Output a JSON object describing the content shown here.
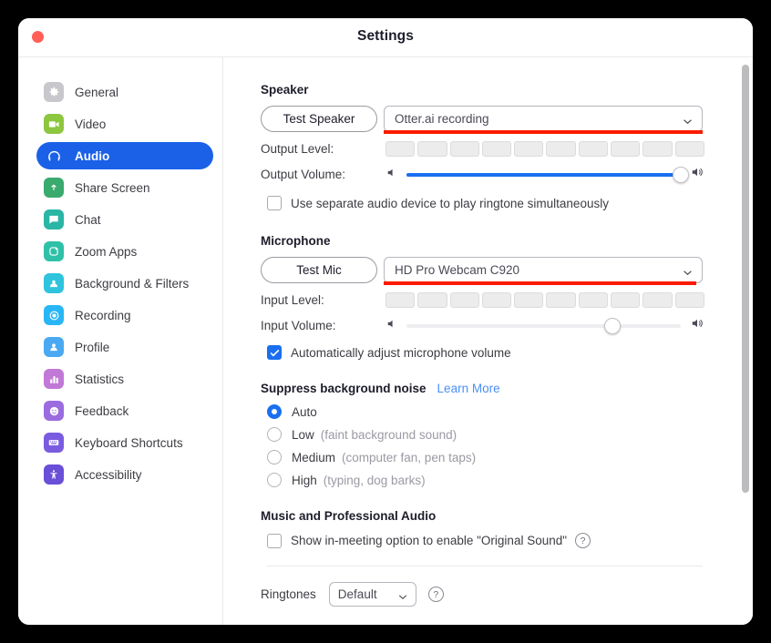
{
  "window": {
    "title": "Settings",
    "close_button": "close"
  },
  "sidebar": {
    "items": [
      {
        "label": "General",
        "icon": "gear-icon",
        "color": "#c7c7cc",
        "active": false
      },
      {
        "label": "Video",
        "icon": "video-camera-icon",
        "color": "#8dc63f",
        "active": false
      },
      {
        "label": "Audio",
        "icon": "headphones-icon",
        "color": "#1a61e8",
        "active": true
      },
      {
        "label": "Share Screen",
        "icon": "share-screen-icon",
        "color": "#3aaa6e",
        "active": false
      },
      {
        "label": "Chat",
        "icon": "chat-bubble-icon",
        "color": "#2ab5a5",
        "active": false
      },
      {
        "label": "Zoom Apps",
        "icon": "zoom-apps-icon",
        "color": "#2fc1a8",
        "active": false
      },
      {
        "label": "Background & Filters",
        "icon": "background-filters-icon",
        "color": "#2fc3de",
        "active": false
      },
      {
        "label": "Recording",
        "icon": "record-circle-icon",
        "color": "#29b6f6",
        "active": false
      },
      {
        "label": "Profile",
        "icon": "person-icon",
        "color": "#4aa9f2",
        "active": false
      },
      {
        "label": "Statistics",
        "icon": "bar-chart-icon",
        "color": "#c278d6",
        "active": false
      },
      {
        "label": "Feedback",
        "icon": "smiley-face-icon",
        "color": "#9b6be0",
        "active": false
      },
      {
        "label": "Keyboard Shortcuts",
        "icon": "keyboard-icon",
        "color": "#7a5ce0",
        "active": false
      },
      {
        "label": "Accessibility",
        "icon": "accessibility-icon",
        "color": "#6a4fd8",
        "active": false
      }
    ]
  },
  "speaker": {
    "heading": "Speaker",
    "test_button": "Test Speaker",
    "device": "Otter.ai recording",
    "output_level_label": "Output Level:",
    "output_level_segments": 10,
    "output_level_filled": 0,
    "output_volume_label": "Output Volume:",
    "output_volume_percent": 100,
    "separate_device_checkbox": {
      "label": "Use separate audio device to play ringtone simultaneously",
      "checked": false
    }
  },
  "microphone": {
    "heading": "Microphone",
    "test_button": "Test Mic",
    "device": "HD Pro Webcam C920",
    "input_level_label": "Input Level:",
    "input_level_segments": 10,
    "input_level_filled": 0,
    "input_volume_label": "Input Volume:",
    "input_volume_percent": 75,
    "auto_adjust_checkbox": {
      "label": "Automatically adjust microphone volume",
      "checked": true
    }
  },
  "suppress_noise": {
    "heading": "Suppress background noise",
    "learn_more": "Learn More",
    "options": [
      {
        "label": "Auto",
        "hint": "",
        "selected": true
      },
      {
        "label": "Low",
        "hint": "(faint background sound)",
        "selected": false
      },
      {
        "label": "Medium",
        "hint": "(computer fan, pen taps)",
        "selected": false
      },
      {
        "label": "High",
        "hint": "(typing, dog barks)",
        "selected": false
      }
    ]
  },
  "music_audio": {
    "heading": "Music and Professional Audio",
    "original_sound_checkbox": {
      "label": "Show in-meeting option to enable \"Original Sound\"",
      "checked": false
    },
    "help_icon": "help-circle-icon"
  },
  "ringtones": {
    "label": "Ringtones",
    "value": "Default",
    "help_icon": "help-circle-icon"
  },
  "annotations": {
    "highlight_color": "#fb1b00",
    "targets": [
      "speaker-device-dropdown",
      "microphone-device-dropdown"
    ]
  },
  "scrollbar": {
    "name": "vertical-scrollbar"
  }
}
